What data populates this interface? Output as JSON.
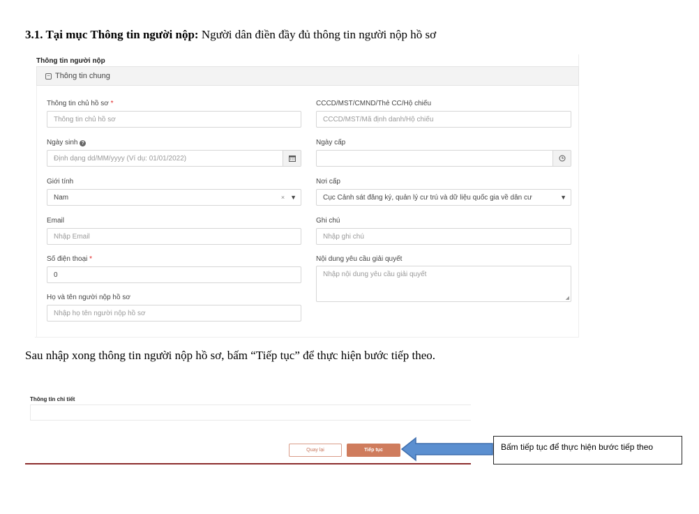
{
  "heading": {
    "bold": "3.1. Tại mục Thông tin người nộp:",
    "rest": " Người dân điền đầy đủ thông tin người nộp hồ sơ"
  },
  "form": {
    "title": "Thông tin người nộp",
    "panel_title": "Thông tin chung",
    "owner": {
      "label": "Thông tin chủ hồ sơ",
      "required": "*",
      "placeholder": "Thông tin chủ hồ sơ"
    },
    "id_number": {
      "label": "CCCD/MST/CMND/Thẻ CC/Hộ chiếu",
      "placeholder": "CCCD/MST/Mã định danh/Hộ chiếu"
    },
    "dob": {
      "label": "Ngày sinh",
      "placeholder": "Định dạng dd/MM/yyyy (Ví dụ: 01/01/2022)"
    },
    "issue_date": {
      "label": "Ngày cấp",
      "value": ""
    },
    "gender": {
      "label": "Giới tính",
      "value": "Nam",
      "clear": "×"
    },
    "issue_place": {
      "label": "Nơi cấp",
      "value": "Cục Cảnh sát đăng ký, quản lý cư trú và dữ liệu quốc gia về dân cư"
    },
    "email": {
      "label": "Email",
      "placeholder": "Nhập Email"
    },
    "note": {
      "label": "Ghi chú",
      "placeholder": "Nhập ghi chú"
    },
    "phone": {
      "label": "Số điện thoại",
      "required": "*",
      "value": "0"
    },
    "request_content": {
      "label": "Nội dung yêu cầu giải quyết",
      "placeholder": "Nhập nội dung yêu cầu giải quyết"
    },
    "submitter_name": {
      "label": "Họ và tên người nộp hồ sơ",
      "placeholder": "Nhập họ tên người nộp hồ sơ"
    }
  },
  "paragraph": "Sau nhập xong thông tin người nộp hồ sơ, bấm “Tiếp tục” để thực hiện bước tiếp theo.",
  "detail": {
    "title": "Thông tin chi tiết",
    "back_label": "Quay lại",
    "next_label": "Tiếp tục"
  },
  "callout": {
    "text": "Bấm tiếp tục để thực hiện bước tiếp theo"
  },
  "colors": {
    "accent": "#cf7c5d",
    "arrow": "#5b8fd0",
    "required": "#e02020"
  },
  "icons": [
    "minus-square-icon",
    "help-circle-icon",
    "calendar-icon",
    "clock-icon",
    "caret-down-icon",
    "clear-icon"
  ]
}
